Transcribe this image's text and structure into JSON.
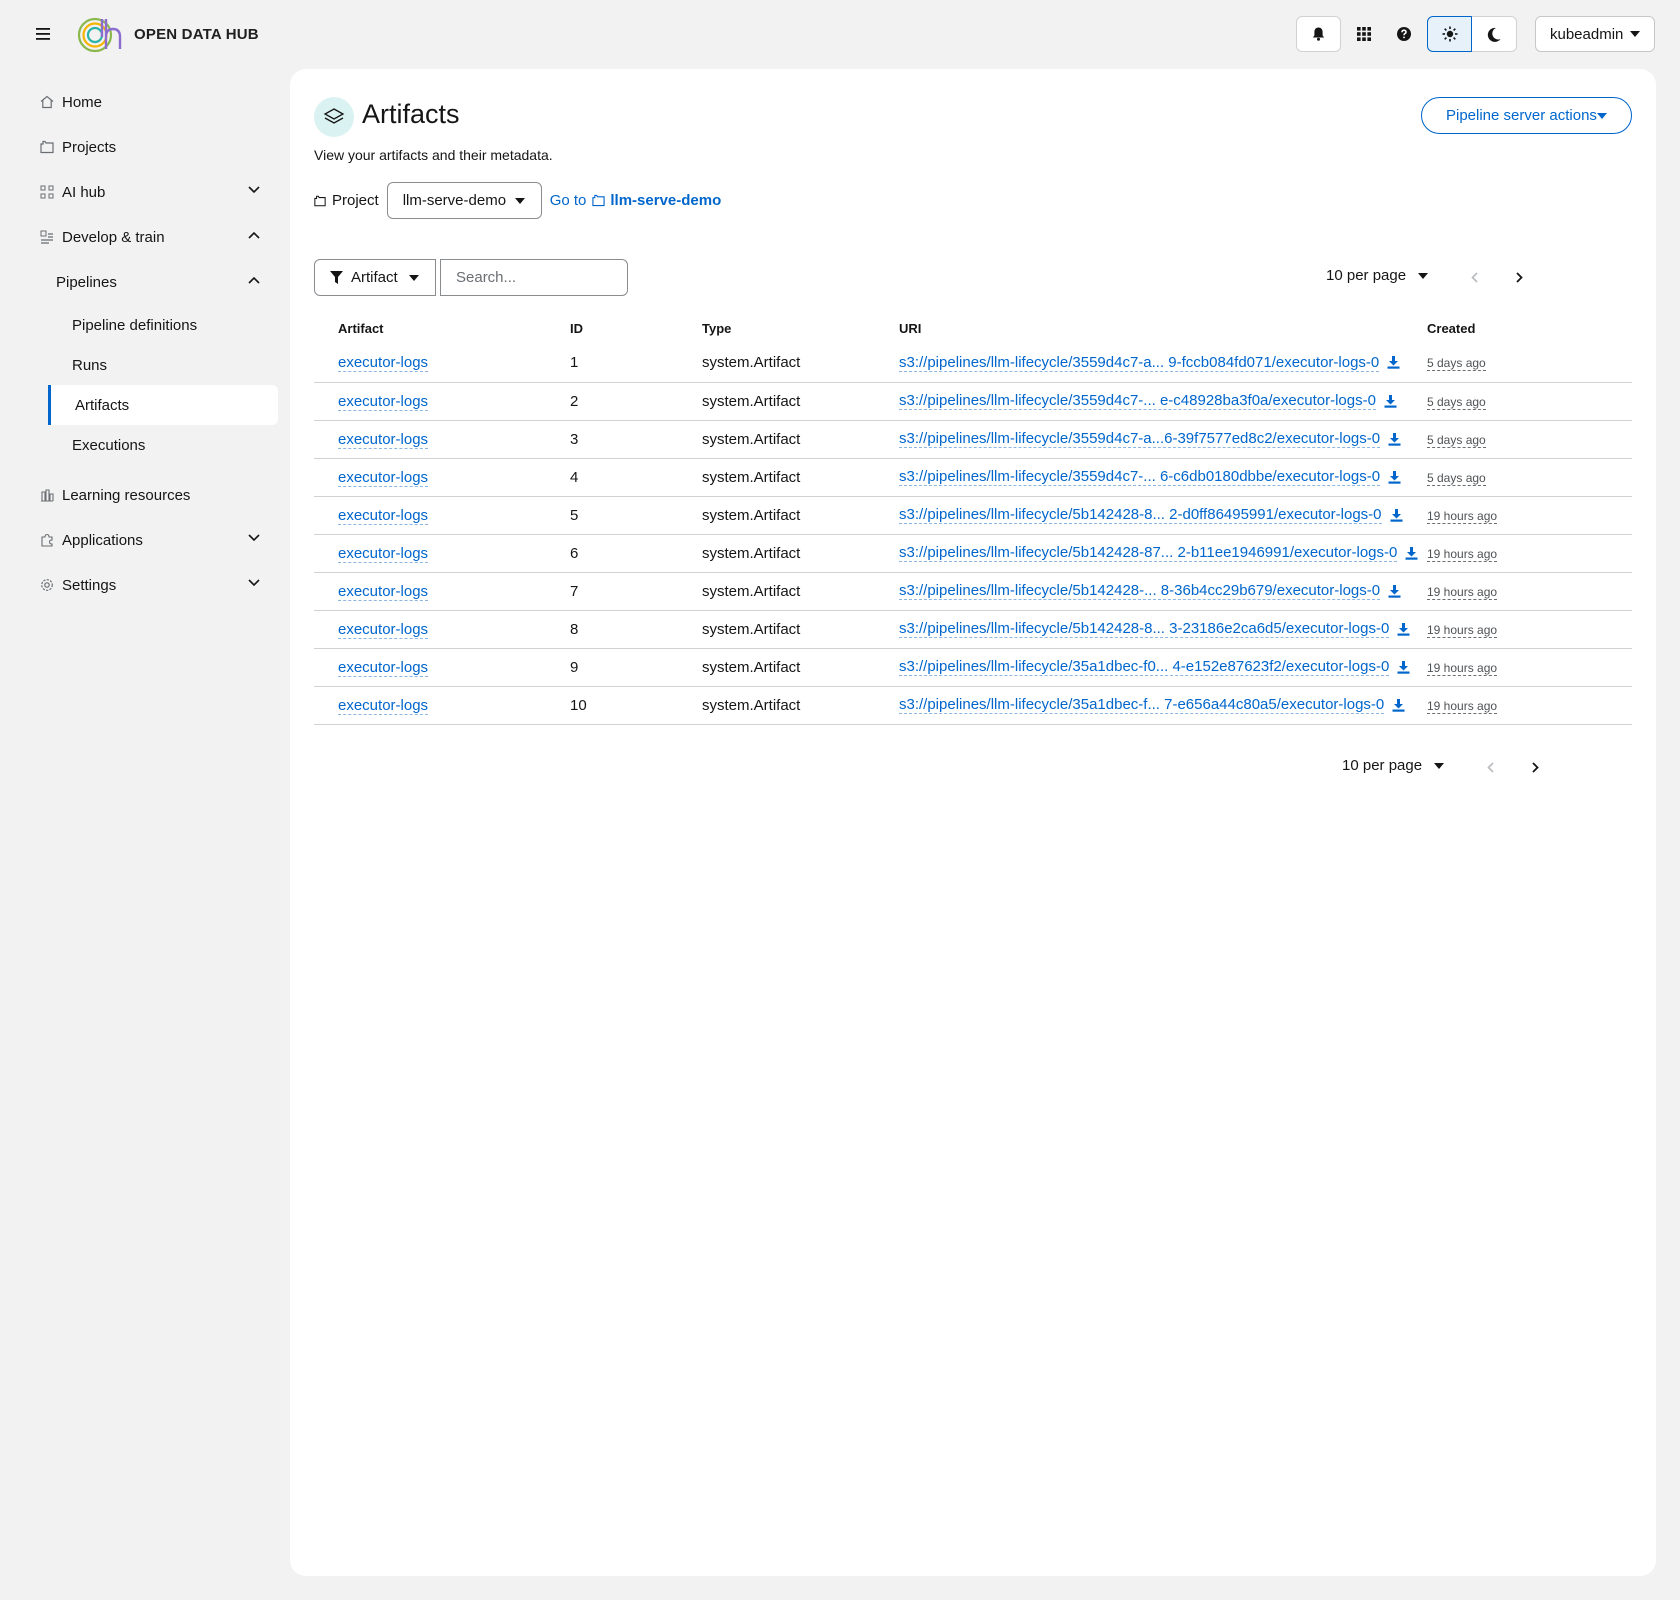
{
  "brand": {
    "name": "OPEN DATA HUB"
  },
  "masthead": {
    "user": "kubeadmin",
    "icons": [
      "bell-icon",
      "grid-icon",
      "help-icon",
      "sun-icon",
      "moon-icon"
    ]
  },
  "sidebar": {
    "items": [
      {
        "label": "Home"
      },
      {
        "label": "Projects"
      },
      {
        "label": "AI hub"
      },
      {
        "label": "Develop & train"
      },
      {
        "label": "Pipelines"
      },
      {
        "label": "Pipeline definitions"
      },
      {
        "label": "Runs"
      },
      {
        "label": "Artifacts"
      },
      {
        "label": "Executions"
      },
      {
        "label": "Learning resources"
      },
      {
        "label": "Applications"
      },
      {
        "label": "Settings"
      }
    ]
  },
  "page": {
    "title": "Artifacts",
    "description": "View your artifacts and their metadata.",
    "server_actions": "Pipeline server actions",
    "project_label": "Project",
    "project_value": "llm-serve-demo",
    "goto_label": "Go to",
    "goto_project": "llm-serve-demo"
  },
  "toolbar": {
    "filter_label": "Artifact",
    "search_placeholder": "Search...",
    "per_page": "10 per page"
  },
  "table": {
    "headers": {
      "artifact": "Artifact",
      "id": "ID",
      "type": "Type",
      "uri": "URI",
      "created": "Created"
    },
    "rows": [
      {
        "artifact": "executor-logs",
        "id": "1",
        "type": "system.Artifact",
        "uri": "s3://pipelines/llm-lifecycle/3559d4c7-a... 9-fccb084fd071/executor-logs-0",
        "created": "5 days ago"
      },
      {
        "artifact": "executor-logs",
        "id": "2",
        "type": "system.Artifact",
        "uri": "s3://pipelines/llm-lifecycle/3559d4c7-... e-c48928ba3f0a/executor-logs-0",
        "created": "5 days ago"
      },
      {
        "artifact": "executor-logs",
        "id": "3",
        "type": "system.Artifact",
        "uri": "s3://pipelines/llm-lifecycle/3559d4c7-a...6-39f7577ed8c2/executor-logs-0",
        "created": "5 days ago"
      },
      {
        "artifact": "executor-logs",
        "id": "4",
        "type": "system.Artifact",
        "uri": "s3://pipelines/llm-lifecycle/3559d4c7-... 6-c6db0180dbbe/executor-logs-0",
        "created": "5 days ago"
      },
      {
        "artifact": "executor-logs",
        "id": "5",
        "type": "system.Artifact",
        "uri": "s3://pipelines/llm-lifecycle/5b142428-8... 2-d0ff86495991/executor-logs-0",
        "created": "19 hours ago"
      },
      {
        "artifact": "executor-logs",
        "id": "6",
        "type": "system.Artifact",
        "uri": "s3://pipelines/llm-lifecycle/5b142428-87... 2-b11ee1946991/executor-logs-0",
        "created": "19 hours ago"
      },
      {
        "artifact": "executor-logs",
        "id": "7",
        "type": "system.Artifact",
        "uri": "s3://pipelines/llm-lifecycle/5b142428-... 8-36b4cc29b679/executor-logs-0",
        "created": "19 hours ago"
      },
      {
        "artifact": "executor-logs",
        "id": "8",
        "type": "system.Artifact",
        "uri": "s3://pipelines/llm-lifecycle/5b142428-8... 3-23186e2ca6d5/executor-logs-0",
        "created": "19 hours ago"
      },
      {
        "artifact": "executor-logs",
        "id": "9",
        "type": "system.Artifact",
        "uri": "s3://pipelines/llm-lifecycle/35a1dbec-f0... 4-e152e87623f2/executor-logs-0",
        "created": "19 hours ago"
      },
      {
        "artifact": "executor-logs",
        "id": "10",
        "type": "system.Artifact",
        "uri": "s3://pipelines/llm-lifecycle/35a1dbec-f... 7-e656a44c80a5/executor-logs-0",
        "created": "19 hours ago"
      }
    ]
  },
  "colors": {
    "link": "#0066cc",
    "background": "#f2f2f2",
    "card": "#ffffff",
    "icon_badge": "#daf2f2"
  }
}
